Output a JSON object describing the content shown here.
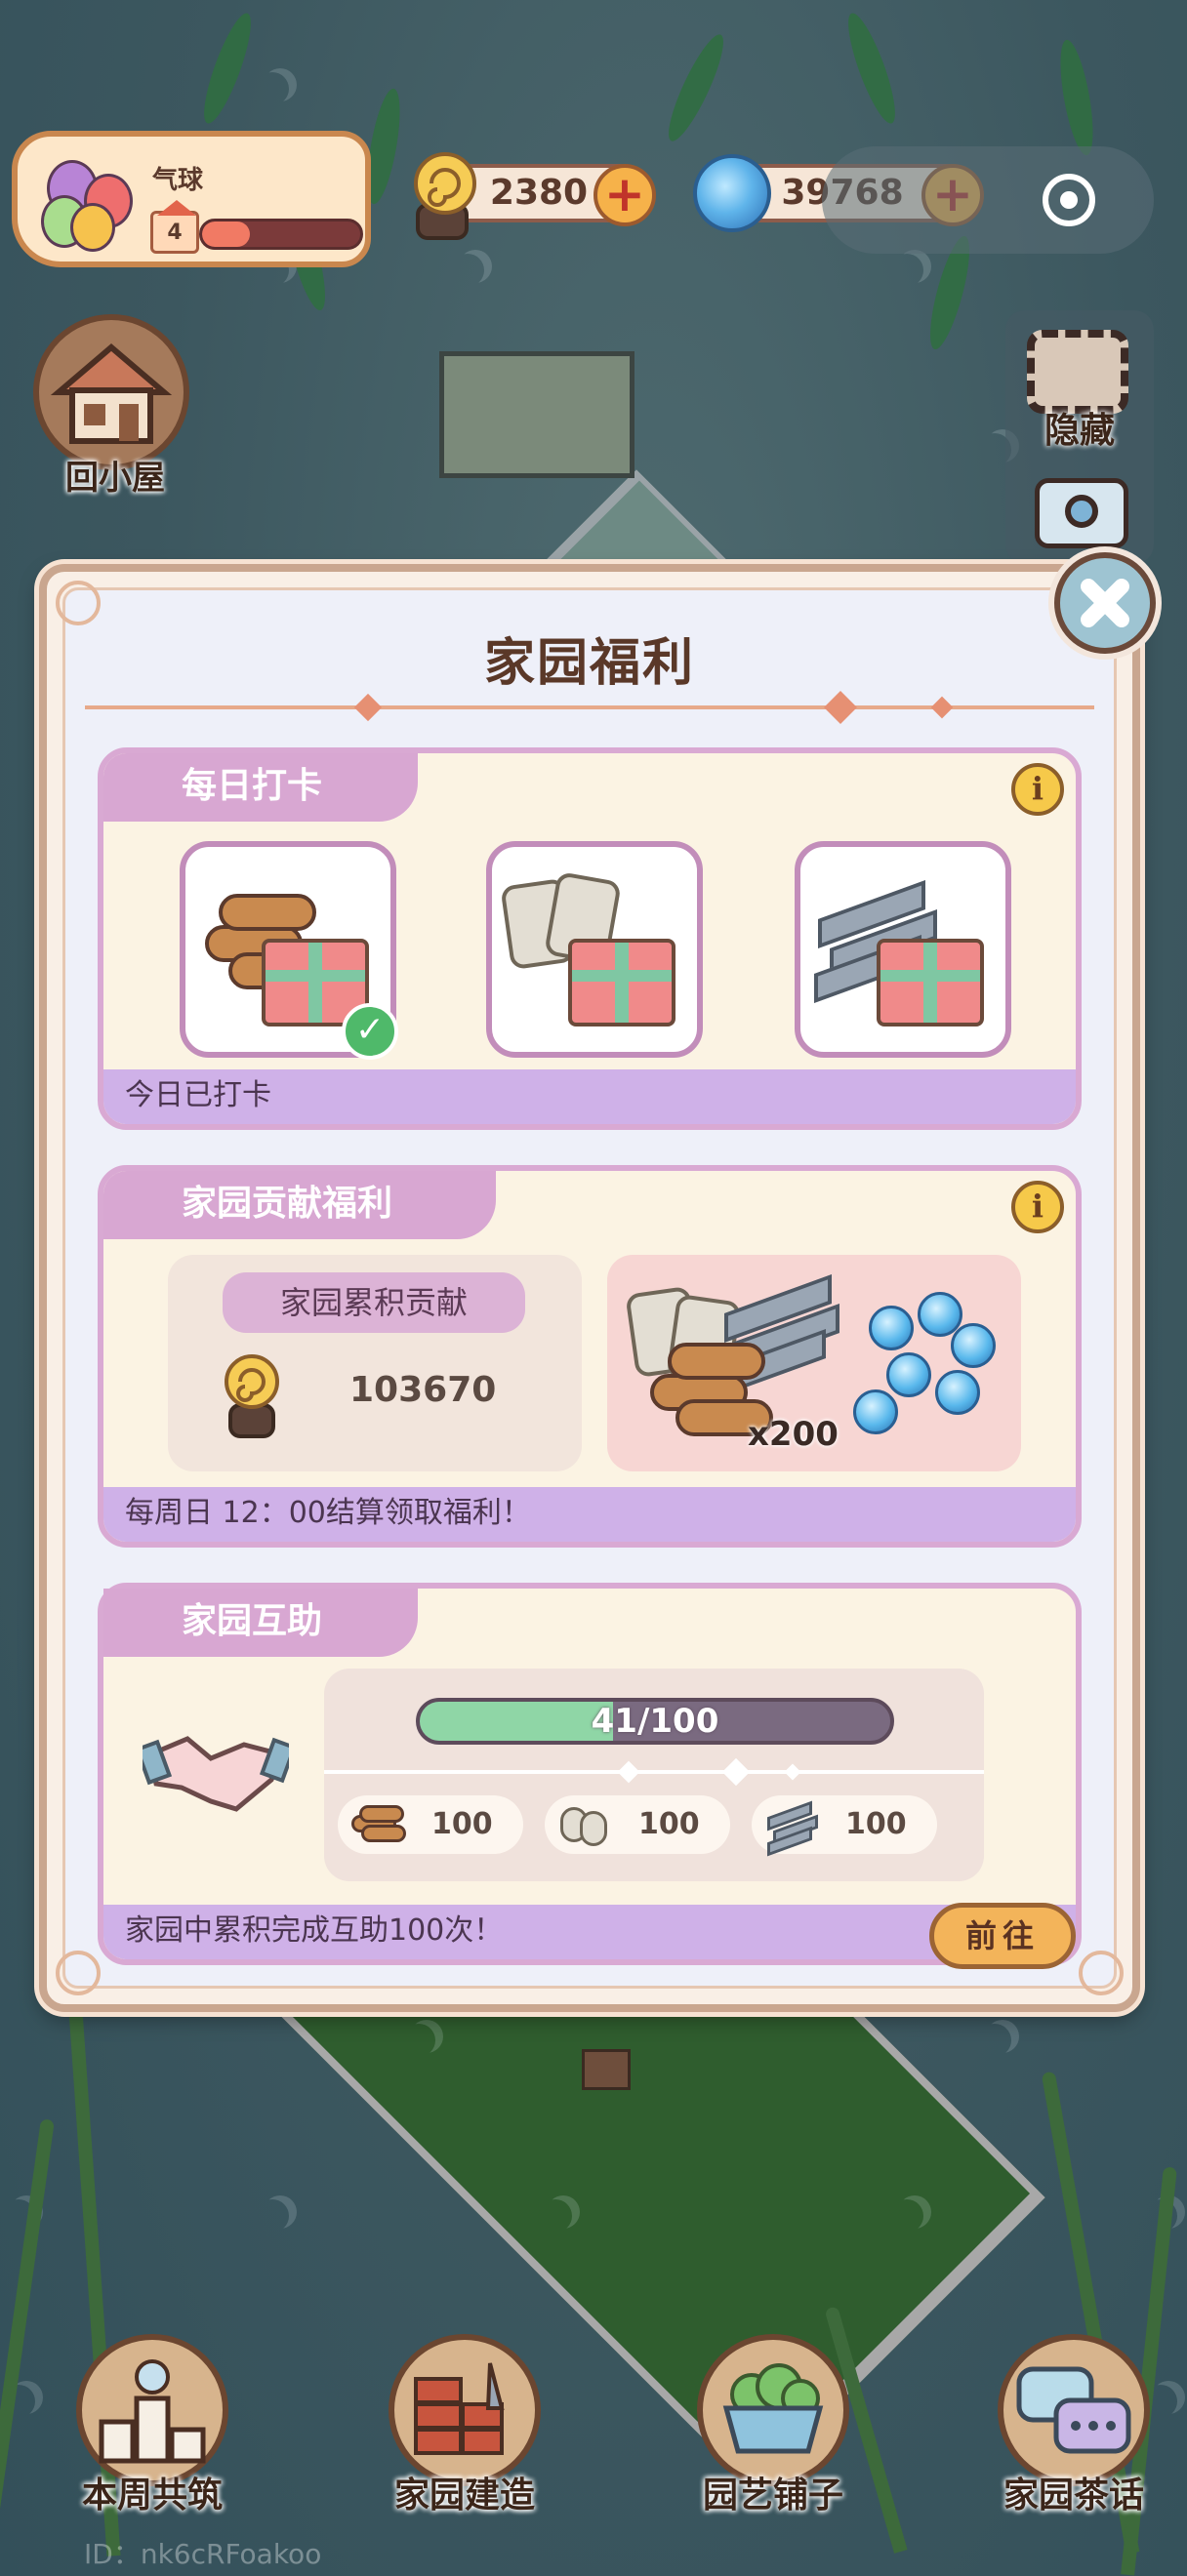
{
  "hud": {
    "balloon_title": "气球",
    "home_level": "4",
    "level_progress": 0.3,
    "snail_coins": "2380",
    "swirl_gems": "39768"
  },
  "side": {
    "home_label": "回小屋",
    "hide_label": "隐藏"
  },
  "modal": {
    "title": "家园福利",
    "checkin": {
      "title": "每日打卡",
      "items": [
        "wood-gift",
        "cement-gift",
        "steel-gift"
      ],
      "status": "今日已打卡"
    },
    "contribution": {
      "title": "家园贡献福利",
      "label": "家园累积贡献",
      "value": "103670",
      "reward_count": "x200",
      "footer": "每周日 12：00结算领取福利！"
    },
    "mutual_help": {
      "title": "家园互助",
      "progress_text": "41/100",
      "progress_value": 0.41,
      "rewards": [
        {
          "icon": "wood-icon",
          "amount": "100"
        },
        {
          "icon": "cement-icon",
          "amount": "100"
        },
        {
          "icon": "steel-icon",
          "amount": "100"
        }
      ],
      "footer": "家园中累积完成互助100次！",
      "go_label": "前往"
    }
  },
  "nav": {
    "weekly_build": "本周共筑",
    "home_build": "家园建造",
    "garden_shop": "园艺铺子",
    "home_tea": "家园茶话"
  },
  "uid_text": "ID：nk6cRFoakoo"
}
